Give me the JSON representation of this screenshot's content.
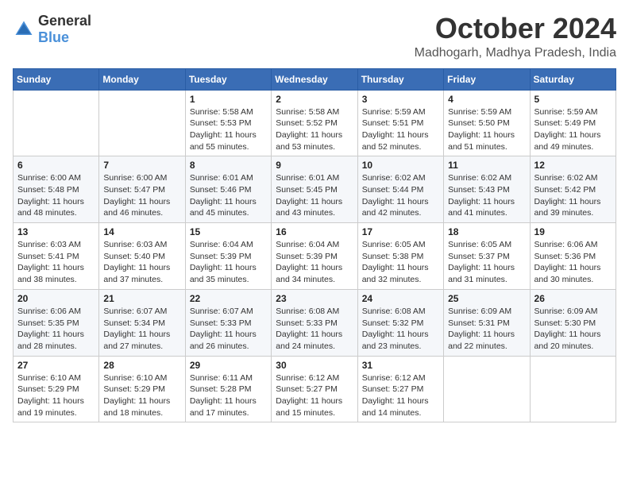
{
  "header": {
    "logo_general": "General",
    "logo_blue": "Blue",
    "title": "October 2024",
    "subtitle": "Madhogarh, Madhya Pradesh, India"
  },
  "calendar": {
    "days_of_week": [
      "Sunday",
      "Monday",
      "Tuesday",
      "Wednesday",
      "Thursday",
      "Friday",
      "Saturday"
    ],
    "weeks": [
      [
        {
          "day": "",
          "info": ""
        },
        {
          "day": "",
          "info": ""
        },
        {
          "day": "1",
          "info": "Sunrise: 5:58 AM\nSunset: 5:53 PM\nDaylight: 11 hours and 55 minutes."
        },
        {
          "day": "2",
          "info": "Sunrise: 5:58 AM\nSunset: 5:52 PM\nDaylight: 11 hours and 53 minutes."
        },
        {
          "day": "3",
          "info": "Sunrise: 5:59 AM\nSunset: 5:51 PM\nDaylight: 11 hours and 52 minutes."
        },
        {
          "day": "4",
          "info": "Sunrise: 5:59 AM\nSunset: 5:50 PM\nDaylight: 11 hours and 51 minutes."
        },
        {
          "day": "5",
          "info": "Sunrise: 5:59 AM\nSunset: 5:49 PM\nDaylight: 11 hours and 49 minutes."
        }
      ],
      [
        {
          "day": "6",
          "info": "Sunrise: 6:00 AM\nSunset: 5:48 PM\nDaylight: 11 hours and 48 minutes."
        },
        {
          "day": "7",
          "info": "Sunrise: 6:00 AM\nSunset: 5:47 PM\nDaylight: 11 hours and 46 minutes."
        },
        {
          "day": "8",
          "info": "Sunrise: 6:01 AM\nSunset: 5:46 PM\nDaylight: 11 hours and 45 minutes."
        },
        {
          "day": "9",
          "info": "Sunrise: 6:01 AM\nSunset: 5:45 PM\nDaylight: 11 hours and 43 minutes."
        },
        {
          "day": "10",
          "info": "Sunrise: 6:02 AM\nSunset: 5:44 PM\nDaylight: 11 hours and 42 minutes."
        },
        {
          "day": "11",
          "info": "Sunrise: 6:02 AM\nSunset: 5:43 PM\nDaylight: 11 hours and 41 minutes."
        },
        {
          "day": "12",
          "info": "Sunrise: 6:02 AM\nSunset: 5:42 PM\nDaylight: 11 hours and 39 minutes."
        }
      ],
      [
        {
          "day": "13",
          "info": "Sunrise: 6:03 AM\nSunset: 5:41 PM\nDaylight: 11 hours and 38 minutes."
        },
        {
          "day": "14",
          "info": "Sunrise: 6:03 AM\nSunset: 5:40 PM\nDaylight: 11 hours and 37 minutes."
        },
        {
          "day": "15",
          "info": "Sunrise: 6:04 AM\nSunset: 5:39 PM\nDaylight: 11 hours and 35 minutes."
        },
        {
          "day": "16",
          "info": "Sunrise: 6:04 AM\nSunset: 5:39 PM\nDaylight: 11 hours and 34 minutes."
        },
        {
          "day": "17",
          "info": "Sunrise: 6:05 AM\nSunset: 5:38 PM\nDaylight: 11 hours and 32 minutes."
        },
        {
          "day": "18",
          "info": "Sunrise: 6:05 AM\nSunset: 5:37 PM\nDaylight: 11 hours and 31 minutes."
        },
        {
          "day": "19",
          "info": "Sunrise: 6:06 AM\nSunset: 5:36 PM\nDaylight: 11 hours and 30 minutes."
        }
      ],
      [
        {
          "day": "20",
          "info": "Sunrise: 6:06 AM\nSunset: 5:35 PM\nDaylight: 11 hours and 28 minutes."
        },
        {
          "day": "21",
          "info": "Sunrise: 6:07 AM\nSunset: 5:34 PM\nDaylight: 11 hours and 27 minutes."
        },
        {
          "day": "22",
          "info": "Sunrise: 6:07 AM\nSunset: 5:33 PM\nDaylight: 11 hours and 26 minutes."
        },
        {
          "day": "23",
          "info": "Sunrise: 6:08 AM\nSunset: 5:33 PM\nDaylight: 11 hours and 24 minutes."
        },
        {
          "day": "24",
          "info": "Sunrise: 6:08 AM\nSunset: 5:32 PM\nDaylight: 11 hours and 23 minutes."
        },
        {
          "day": "25",
          "info": "Sunrise: 6:09 AM\nSunset: 5:31 PM\nDaylight: 11 hours and 22 minutes."
        },
        {
          "day": "26",
          "info": "Sunrise: 6:09 AM\nSunset: 5:30 PM\nDaylight: 11 hours and 20 minutes."
        }
      ],
      [
        {
          "day": "27",
          "info": "Sunrise: 6:10 AM\nSunset: 5:29 PM\nDaylight: 11 hours and 19 minutes."
        },
        {
          "day": "28",
          "info": "Sunrise: 6:10 AM\nSunset: 5:29 PM\nDaylight: 11 hours and 18 minutes."
        },
        {
          "day": "29",
          "info": "Sunrise: 6:11 AM\nSunset: 5:28 PM\nDaylight: 11 hours and 17 minutes."
        },
        {
          "day": "30",
          "info": "Sunrise: 6:12 AM\nSunset: 5:27 PM\nDaylight: 11 hours and 15 minutes."
        },
        {
          "day": "31",
          "info": "Sunrise: 6:12 AM\nSunset: 5:27 PM\nDaylight: 11 hours and 14 minutes."
        },
        {
          "day": "",
          "info": ""
        },
        {
          "day": "",
          "info": ""
        }
      ]
    ]
  }
}
